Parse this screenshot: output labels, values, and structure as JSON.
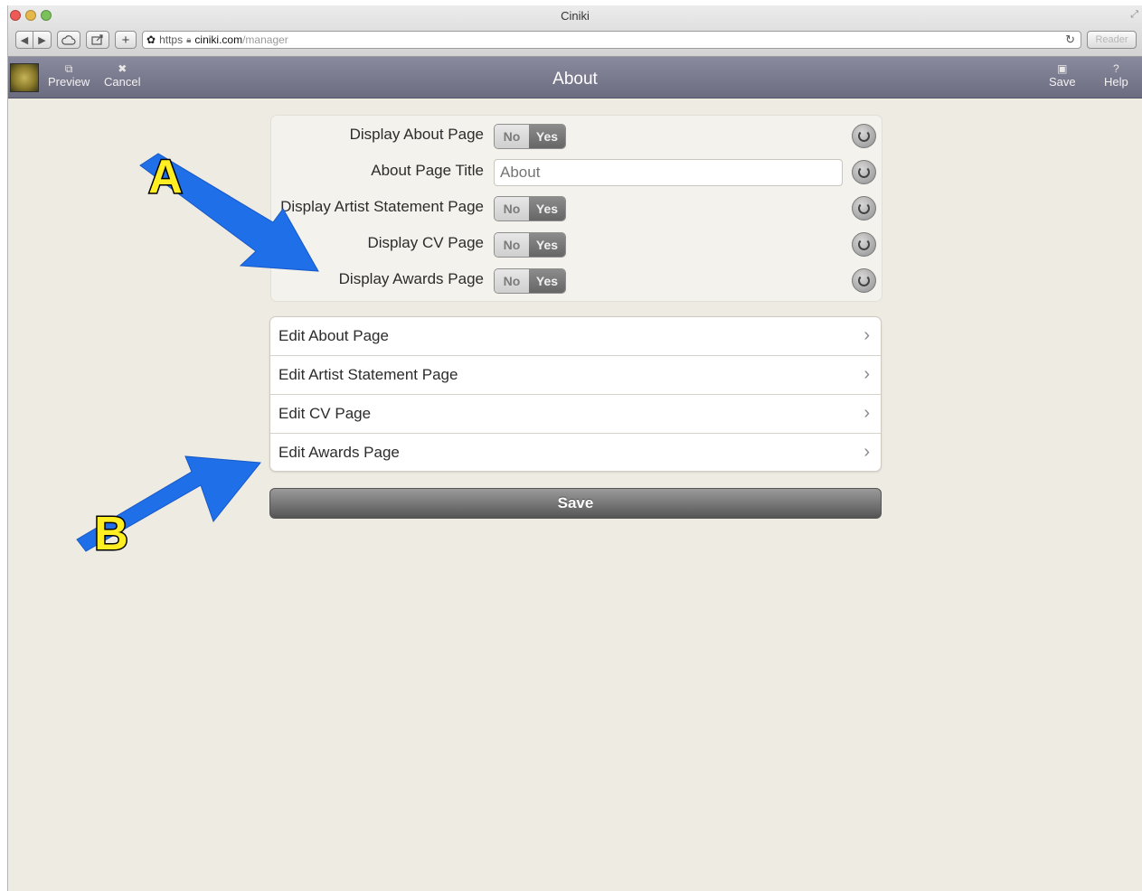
{
  "window": {
    "title": "Ciniki"
  },
  "browser": {
    "address": {
      "scheme": "https",
      "host": "ciniki.com",
      "path": "/manager"
    },
    "reader_label": "Reader",
    "reload_glyph": "↻"
  },
  "appbar": {
    "title": "About",
    "left_buttons": [
      {
        "label": "Preview",
        "icon": "external-link-icon"
      },
      {
        "label": "Cancel",
        "icon": "close-icon"
      }
    ],
    "right_buttons": [
      {
        "label": "Save",
        "icon": "floppy-disk-icon"
      },
      {
        "label": "Help",
        "icon": "question-icon"
      }
    ]
  },
  "settings": {
    "rows": [
      {
        "label": "Display About Page",
        "type": "toggle",
        "off_label": "No",
        "on_label": "Yes",
        "value": "Yes"
      },
      {
        "label": "About Page Title",
        "type": "text",
        "placeholder": "About",
        "value": ""
      },
      {
        "label": "Display Artist Statement Page",
        "type": "toggle",
        "off_label": "No",
        "on_label": "Yes",
        "value": "Yes"
      },
      {
        "label": "Display CV Page",
        "type": "toggle",
        "off_label": "No",
        "on_label": "Yes",
        "value": "Yes"
      },
      {
        "label": "Display Awards Page",
        "type": "toggle",
        "off_label": "No",
        "on_label": "Yes",
        "value": "Yes"
      }
    ]
  },
  "edit_links": [
    {
      "label": "Edit About Page"
    },
    {
      "label": "Edit Artist Statement Page"
    },
    {
      "label": "Edit CV Page"
    },
    {
      "label": "Edit Awards Page"
    }
  ],
  "save_button": {
    "label": "Save"
  },
  "annotations": [
    {
      "letter": "A",
      "color": "#1f6fe8"
    },
    {
      "letter": "B",
      "color": "#1f6fe8"
    }
  ],
  "colors": {
    "accent_arrow": "#1f6fe8",
    "callout_fill": "#ffee22",
    "appbar": "#7b7b90",
    "page_bg": "#eeebe2"
  }
}
